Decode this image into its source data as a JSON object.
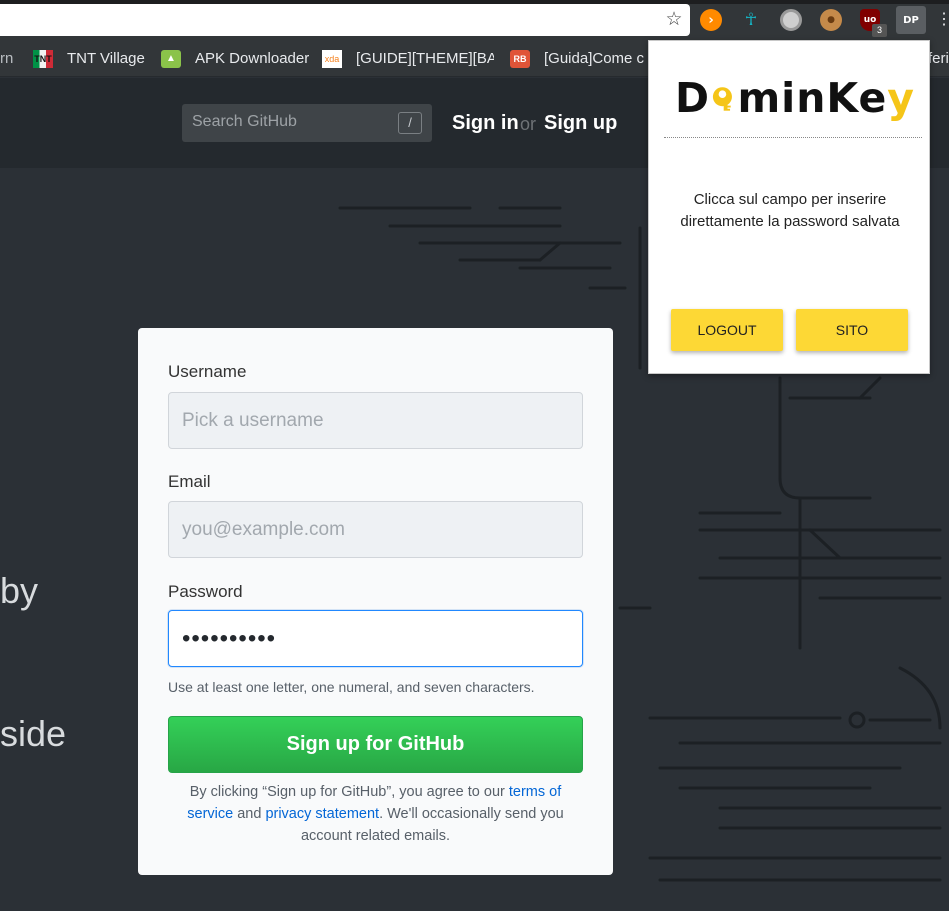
{
  "browser": {
    "bookmarks": [
      {
        "label": "TNT Village",
        "icon": "tnt-flag-icon",
        "icon_text": "TNT"
      },
      {
        "label": "APK Downloader",
        "icon": "android-icon"
      },
      {
        "label": "[GUIDE][THEME][BAS",
        "icon": "xda-icon",
        "icon_text": "xda"
      },
      {
        "label": "[Guida]Come cr",
        "icon": "rb-icon",
        "icon_text": "RB"
      }
    ],
    "bookmark_partial_left": "rn:",
    "bookmark_partial_right": "feri",
    "extensions": [
      "orange-play-icon",
      "runner-icon",
      "circle-icon",
      "cookie-icon",
      "ublock-icon",
      "dominkey-icon"
    ],
    "ublock_badge": "3",
    "ublock_text": "uo",
    "dominkey_icon_text": "DP"
  },
  "github": {
    "search_placeholder": "Search GitHub",
    "search_shortcut": "/",
    "sign_in": "Sign in",
    "or": "or",
    "sign_up": "Sign up",
    "hero_fragment_1": "by",
    "hero_fragment_2": "side",
    "form": {
      "username_label": "Username",
      "username_placeholder": "Pick a username",
      "email_label": "Email",
      "email_placeholder": "you@example.com",
      "password_label": "Password",
      "password_value": "••••••••••",
      "password_hint": "Use at least one letter, one numeral, and seven characters.",
      "submit": "Sign up for GitHub",
      "terms_prefix": "By clicking “Sign up for GitHub”, you agree to our ",
      "terms_link": "terms of service",
      "terms_and": " and ",
      "privacy_link": "privacy statement",
      "terms_suffix": ". We'll occasionally send you account related emails."
    }
  },
  "popup": {
    "logo_d": "D",
    "logo_rest_1": "minKe",
    "logo_rest_2": "y",
    "message": "Clicca sul campo per inserire direttamente la password salvata",
    "logout": "LOGOUT",
    "sito": "SITO"
  },
  "colors": {
    "github_header": "#24292e",
    "page_background": "#2b3036",
    "signup_green": "#28a745",
    "popup_button_yellow": "#fdd835",
    "link_blue": "#0366d6",
    "focus_blue": "#2188ff"
  }
}
